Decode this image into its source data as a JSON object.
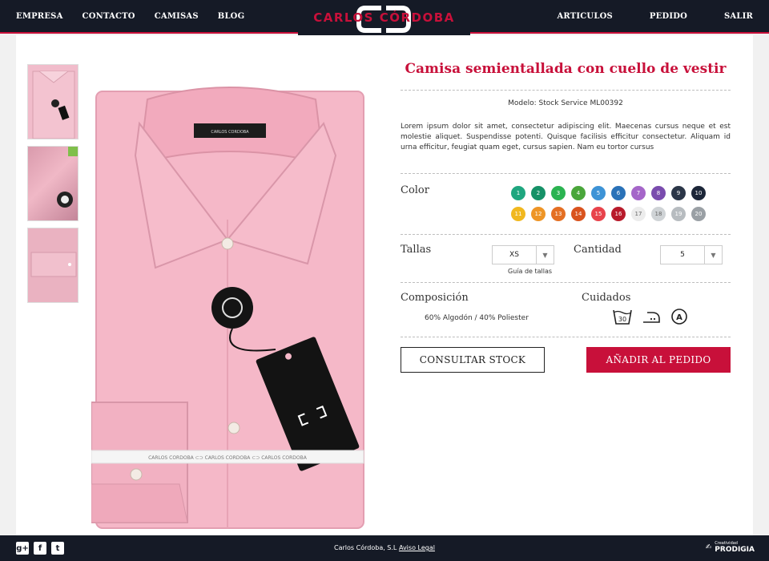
{
  "nav": {
    "left": [
      "EMPRESA",
      "CONTACTO",
      "CAMISAS",
      "BLOG"
    ],
    "right": [
      "ARTICULOS",
      "PEDIDO",
      "SALIR"
    ]
  },
  "brand": {
    "name": "CARLOS CÓRDOBA",
    "accent": "#c8103a",
    "dark": "#151a26"
  },
  "product": {
    "title": "Camisa semientallada con cuello de vestir",
    "model": "Modelo: Stock Service ML00392",
    "description": "Lorem ipsum dolor sit amet, consectetur adipiscing elit. Maecenas cursus neque et est molestie aliquet. Suspendisse potenti. Quisque facilisis efficitur consectetur. Aliquam id urna efficitur, feugiat quam eget, cursus sapien. Nam eu tortor cursus",
    "color_label": "Color",
    "colors_row1": [
      {
        "n": "1",
        "c": "#1fa67f"
      },
      {
        "n": "2",
        "c": "#169167"
      },
      {
        "n": "3",
        "c": "#2bb351"
      },
      {
        "n": "4",
        "c": "#4aa63b"
      },
      {
        "n": "5",
        "c": "#3d93d6"
      },
      {
        "n": "6",
        "c": "#2a72b8"
      },
      {
        "n": "7",
        "c": "#a566c9"
      },
      {
        "n": "8",
        "c": "#7a4cae"
      },
      {
        "n": "9",
        "c": "#2b3648"
      },
      {
        "n": "10",
        "c": "#1c2638"
      }
    ],
    "colors_row2": [
      {
        "n": "11",
        "c": "#f1b81f"
      },
      {
        "n": "12",
        "c": "#ee9526"
      },
      {
        "n": "13",
        "c": "#e46f23"
      },
      {
        "n": "14",
        "c": "#d9531e"
      },
      {
        "n": "15",
        "c": "#e8434b"
      },
      {
        "n": "16",
        "c": "#b81b2b"
      },
      {
        "n": "17",
        "c": "#ececec"
      },
      {
        "n": "18",
        "c": "#cfd3d6"
      },
      {
        "n": "19",
        "c": "#b7bcc0"
      },
      {
        "n": "20",
        "c": "#9aa0a5"
      }
    ],
    "sizes_label": "Tallas",
    "size_value": "XS",
    "size_guide": "Guía de tallas",
    "qty_label": "Cantidad",
    "qty_value": "5",
    "composition_label": "Composición",
    "composition_value": "60% Algodón / 40% Poliester",
    "care_label": "Cuidados",
    "care_icons": [
      "wash-30-icon",
      "iron-low-icon",
      "dry-clean-a-icon"
    ],
    "care_wash_temp": "30",
    "care_dry_clean": "A",
    "stock_button": "CONSULTAR STOCK",
    "add_button": "AÑADIR AL PEDIDO"
  },
  "footer": {
    "company": "Carlos Córdoba, S.L",
    "legal": "Aviso Legal",
    "agency_small": "Creatividad",
    "agency": "PRODIGIA",
    "social": [
      "google-plus-icon",
      "facebook-icon",
      "twitter-icon"
    ]
  }
}
